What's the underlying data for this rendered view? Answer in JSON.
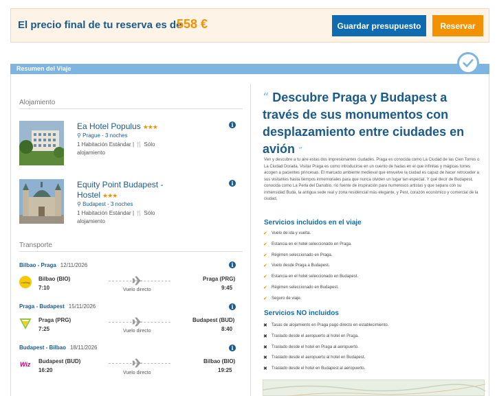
{
  "price_bar": {
    "text": "El precio final de tu reserva es de",
    "price": "558 €",
    "save_button": "Guardar presupuesto",
    "book_button": "Reservar"
  },
  "summary": {
    "title": "Resumen del Viaje"
  },
  "accommodation": {
    "section_title": "Alojamiento",
    "hotels": [
      {
        "name": "Ea Hotel Populus",
        "stars": "★★★",
        "location": "Prague - 3 noches",
        "room": "1 Habitación Estándar | 🍴 Sólo alojamiento"
      },
      {
        "name": "Equity Point Budapest - Hostel",
        "stars": "★★★",
        "location": "Budapest - 3 noches",
        "room": "1 Habitación Estándar | 🍴 Sólo alojamiento"
      }
    ]
  },
  "transport": {
    "section_title": "Transporte",
    "flights": [
      {
        "route": "Bilbao - Praga",
        "date": "12/11/2026",
        "from": "Bilbao (BIO)",
        "dep": "7:10",
        "to": "Praga (PRG)",
        "arr": "9:45",
        "type": "Vuelo directo"
      },
      {
        "route": "Praga - Budapest",
        "date": "15/11/2026",
        "from": "Praga (PRG)",
        "dep": "7:25",
        "to": "Budapest (BUD)",
        "arr": "8:40",
        "type": "Vuelo directo"
      },
      {
        "route": "Budapest - Bilbao",
        "date": "18/11/2026",
        "from": "Budapest (BUD)",
        "dep": "16:20",
        "to": "Bilbao (BIO)",
        "arr": "19:25",
        "type": "Vuelo directo"
      }
    ]
  },
  "description": {
    "title": "Descubre Praga y Budapest a través de sus monumentos con desplazamiento entre ciudades en avión",
    "open_quote": "“",
    "close_quote": "”",
    "body": "Ven y descubre a tu aire estas dos impresionantes ciudades. Praga es conocida como La Ciudad de las Cien Torres o La Ciudad Dorada. Visitar Praga es como introducirse en un cuento de hadas en el que infinitas y mágicas torres acogen a pacientes princesas. El marcado ambiente medieval que envuelve la ciudad es capaz de hacer retroceder a sus visitantes hasta tiempos inmemoriales para que nunca olviden un lugar tan especial. Y qué decir de Budapest, conocida como La Perla del Danubio, río fuente de inspiración para numerosos artistas y que separa con su inmensidad Buda, la antigua sede real y zona residencial más elegante, y Pest, corazón económico y comercial de la ciudad.",
    "included_title": "Servicios incluidos en el viaje",
    "included": [
      "Vuelo de ida y vuelta.",
      "Estancia en el hotel seleccionado en Praga.",
      "Régimen seleccionado en Praga.",
      "Vuelo desde Praga a Budapest.",
      "Estancia en el hotel seleccionado en Budapest.",
      "Régimen seleccionado en Budapest.",
      "Seguro de viaje."
    ],
    "not_included_title": "Servicios NO incluidos",
    "not_included": [
      "Tasas de alojamiento en Praga pago directo en establecimiento.",
      "Traslado desde el aeropuerto al hotel en Praga.",
      "Traslado desde el hotel en Praga al aeropuerto.",
      "Traslado desde el aeropuerto al hotel en Budapest.",
      "Traslado desde el hotel en Budapest al aeropuerto."
    ]
  },
  "colors": {
    "brand_blue": "#1a5a8c",
    "accent_orange": "#f39200",
    "header_blue": "#7db4e0"
  }
}
